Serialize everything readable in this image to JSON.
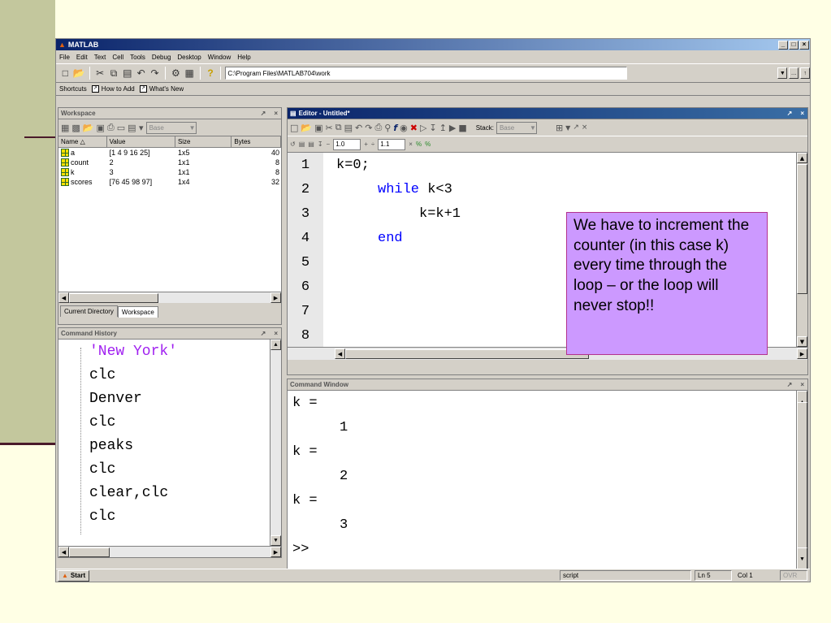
{
  "window": {
    "title": "MATLAB"
  },
  "menu": [
    "File",
    "Edit",
    "Text",
    "Cell",
    "Tools",
    "Debug",
    "Desktop",
    "Window",
    "Help"
  ],
  "toolbar": {
    "current_dir": "C:\\Program Files\\MATLAB704\\work"
  },
  "shortcuts": {
    "label": "Shortcuts",
    "items": [
      "How to Add",
      "What's New"
    ]
  },
  "workspace": {
    "title": "Workspace",
    "base_label": "Base",
    "columns": [
      "Name",
      "Value",
      "Size",
      "Bytes"
    ],
    "rows": [
      {
        "name": "a",
        "value": "[1 4 9 16 25]",
        "size": "1x5",
        "bytes": "40"
      },
      {
        "name": "count",
        "value": "2",
        "size": "1x1",
        "bytes": "8"
      },
      {
        "name": "k",
        "value": "3",
        "size": "1x1",
        "bytes": "8"
      },
      {
        "name": "scores",
        "value": "[76 45 98 97]",
        "size": "1x4",
        "bytes": "32"
      }
    ],
    "tabs": [
      "Current Directory",
      "Workspace"
    ]
  },
  "history": {
    "title": "Command History",
    "lines": [
      "'New York'",
      "clc",
      "Denver",
      "clc",
      "peaks",
      "clc",
      "clear,clc",
      "clc"
    ]
  },
  "editor": {
    "title": "Editor - Untitled*",
    "stack_label": "Stack:",
    "stack_value": "Base",
    "zoom1": "1.0",
    "zoom2": "1.1",
    "line_numbers": [
      "1",
      "2",
      "3",
      "4",
      "5",
      "6",
      "7",
      "8"
    ],
    "code": {
      "l1": "k=0;",
      "l2_kw": "while",
      "l2_rest": " k<3",
      "l3": "k=k+1",
      "l4_kw": "end"
    }
  },
  "command_window": {
    "title": "Command Window",
    "lines": [
      "k =",
      "1",
      "k =",
      "2",
      "k =",
      "3",
      ">>"
    ]
  },
  "callout": {
    "text": "We have to increment the counter (in this case k) every time through the loop – or the loop will never stop!!"
  },
  "status": {
    "start": "Start",
    "mode": "script",
    "ln": "Ln  5",
    "col": "Col  1",
    "ovr": "OVR"
  }
}
